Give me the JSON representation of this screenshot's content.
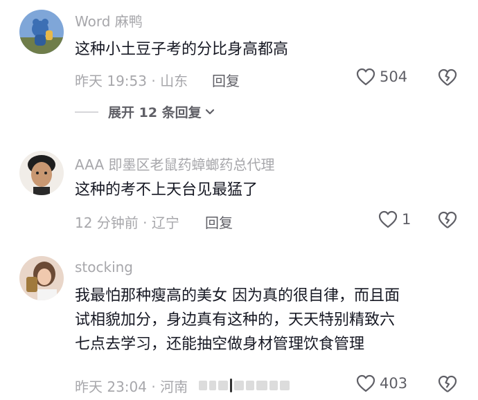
{
  "comments": [
    {
      "username": "Word 麻鸭",
      "text": "这种小土豆子考的分比身高都高",
      "meta": "昨天 19:53 · 山东",
      "reply_label": "回复",
      "like_count": "504",
      "expand_label": "展开 12 条回复"
    },
    {
      "username": "AAA 即墨区老鼠药蟑螂药总代理",
      "text": "这种的考不上天台见最猛了",
      "meta": "12 分钟前 · 辽宁",
      "reply_label": "回复",
      "like_count": "1"
    },
    {
      "username": "stocking",
      "text_lines": [
        "我最怕那种瘦高的美女 因为真的很自律，而且面",
        "试相貌加分，身边真有这种的，天天特别精致六",
        "七点去学习，还能抽空做身材管理饮食管理"
      ],
      "meta": "昨天 23:04 · 河南",
      "like_count": "403"
    }
  ],
  "icons": {
    "like": "heart-outline-icon",
    "dislike": "broken-heart-icon",
    "expand": "chevron-down-icon"
  },
  "colors": {
    "text_primary": "#161823",
    "text_secondary": "#a7a7ab",
    "text_action": "#5f5f66"
  }
}
